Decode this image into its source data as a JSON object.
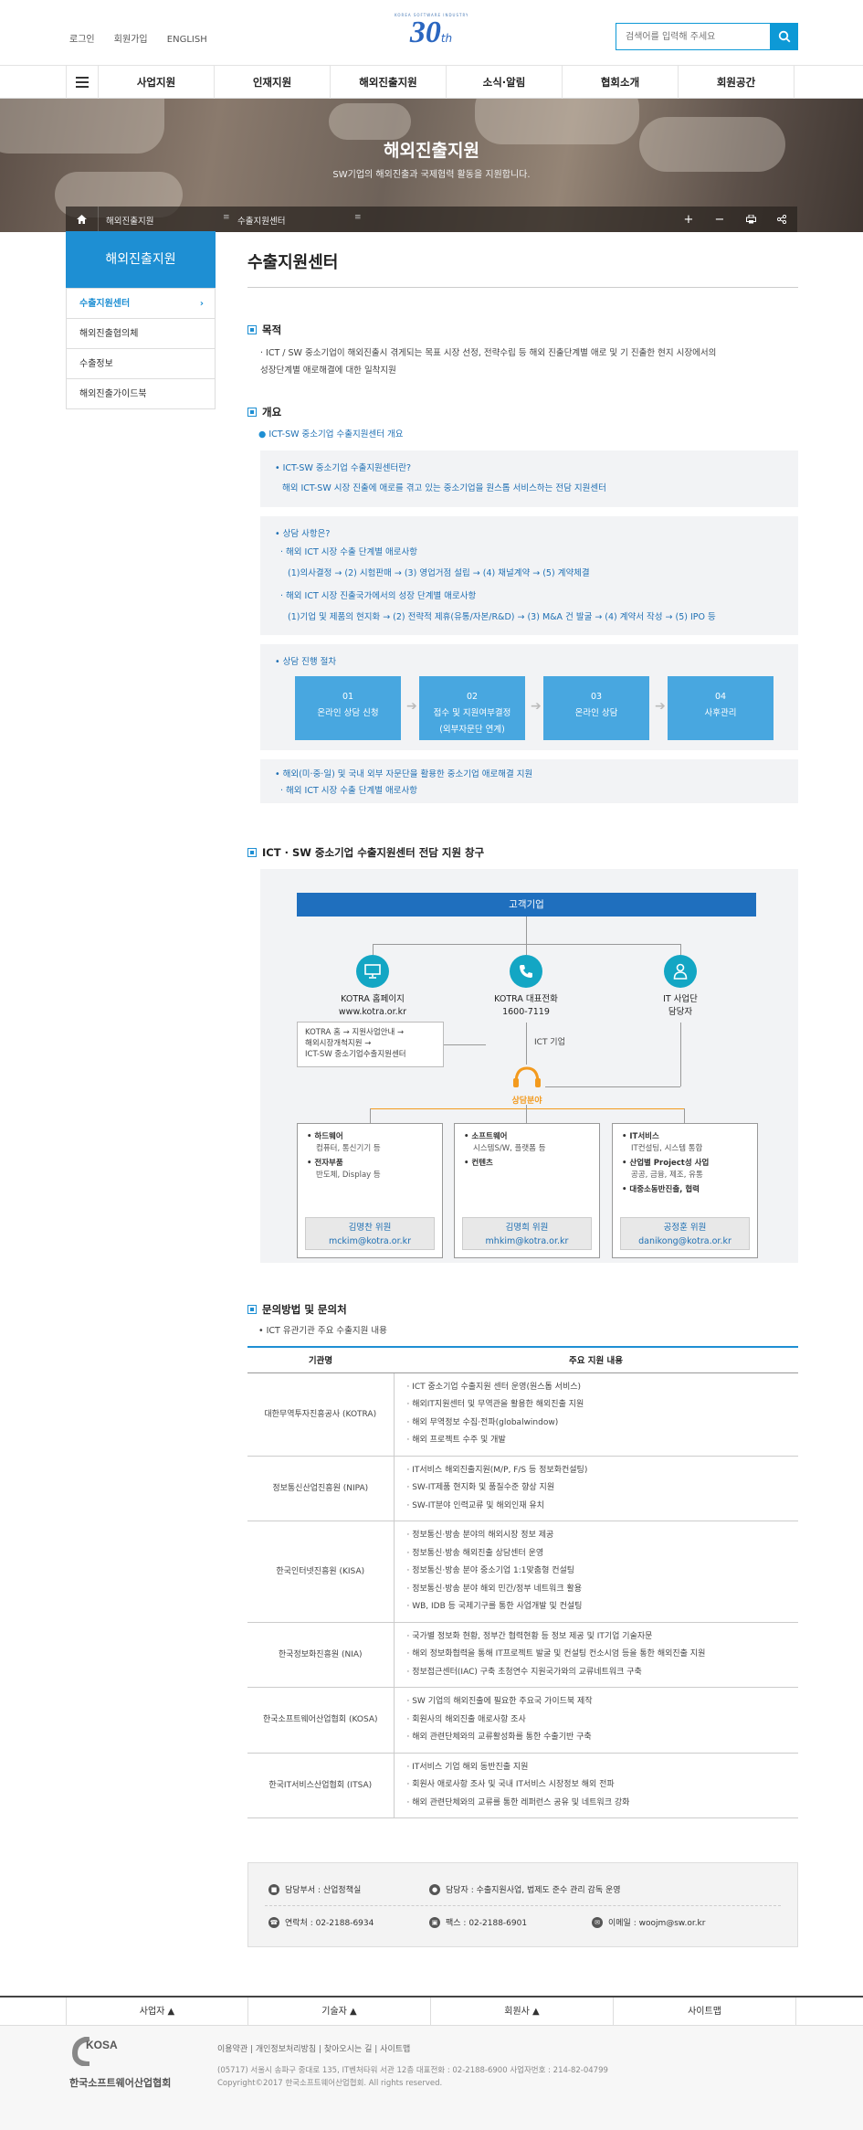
{
  "header": {
    "util_links": [
      "로그인",
      "회원가입",
      "ENGLISH"
    ],
    "logo_arc_text": "KOREA SOFTWARE INDUSTRY ASSOCIATION",
    "logo_number": "30",
    "logo_suffix": "th",
    "search_placeholder": "검색어를 입력해 주세요"
  },
  "nav": {
    "items": [
      "사업지원",
      "인재지원",
      "해외진출지원",
      "소식·알림",
      "협회소개",
      "회원공간"
    ]
  },
  "banner": {
    "title": "해외진출지원",
    "subtitle": "SW기업의 해외진출과 국제협력 활동을 지원합니다."
  },
  "breadcrumb": {
    "level1": "해외진출지원",
    "level2": "수출지원센터"
  },
  "sidebar": {
    "title": "해외진출지원",
    "items": [
      "수출지원센터",
      "해외진출협의체",
      "수출정보",
      "해외진출가이드북"
    ]
  },
  "page_title": "수출지원센터",
  "purpose": {
    "heading": "목적",
    "text1": "· ICT / SW 중소기업이 해외진출시 겪게되는 목표 시장 선정, 전략수립 등 해외 진출단계별 애로 및 기 진출한 현지 시장에서의",
    "text2": "성장단계별 애로해결에 대한 일착지원"
  },
  "overview": {
    "heading": "개요",
    "sub": "ICT-SW 중소기업 수출지원센터 개요",
    "q1": "• ICT-SW 중소기업 수출지원센터란?",
    "a1": "해외 ICT-SW 시장 진출에 애로를 겪고 있는 중소기업을 원스톱 서비스하는 전담 지원센터",
    "q2": "• 상담 사항은?",
    "l1": "· 해외 ICT 시장 수출 단계별 애로사항",
    "l1d": "(1)의사결정 → (2) 시험판매 → (3) 영업거점 설립 → (4) 채널계약 → (5) 계약체결",
    "l2": "· 해외 ICT 시장 진출국가에서의 성장 단계별 애로사항",
    "l2d": "(1)기업 및 제품의 현지화 → (2) 전략적 제휴(유통/자본/R&D) → (3) M&A 건 발굴 → (4) 계약서 작성 → (5) IPO 등",
    "q3": "• 상담 진행 절차",
    "steps": [
      {
        "num": "01",
        "label": "온라인 상담 신청",
        "label2": ""
      },
      {
        "num": "02",
        "label": "접수 및 지원여부결정",
        "label2": "(외부자문단 연계)"
      },
      {
        "num": "03",
        "label": "온라인 상담",
        "label2": ""
      },
      {
        "num": "04",
        "label": "사후관리",
        "label2": ""
      }
    ],
    "q4": "• 해외(미·중·일) 및 국내 외부 자문단을 활용한 중소기업 애로해결 지원",
    "l4": "· 해외 ICT 시장 수출 단계별 애로사항"
  },
  "diagram": {
    "heading": "ICT · SW 중소기업 수출지원센터 전담 지원 창구",
    "customer": "고객기업",
    "c1_title": "KOTRA 홈페이지",
    "c1_sub": "www.kotra.or.kr",
    "c2_title": "KOTRA 대표전화",
    "c2_sub": "1600-7119",
    "c3_title": "IT 사업단",
    "c3_sub": "담당자",
    "path1": "KOTRA 홈 → 지원사업안내 →",
    "path2": "해외시장개척지원 →",
    "path3": "ICT-SW 중소기업수출지원센터",
    "ict_label": "ICT 기업",
    "consult_label": "상담분야",
    "fields": [
      {
        "h1": "• 하드웨어",
        "d1": "컴퓨터, 통신기기 등",
        "h2": "• 전자부품",
        "d2": "반도체, Display 등",
        "h3": "",
        "d3": "",
        "person": "김명찬 위원",
        "email": "mckim@kotra.or.kr"
      },
      {
        "h1": "• 소프트웨어",
        "d1": "시스템S/W, 플랫폼 등",
        "h2": "• 컨텐츠",
        "d2": "",
        "h3": "",
        "d3": "",
        "person": "김명희 위원",
        "email": "mhkim@kotra.or.kr"
      },
      {
        "h1": "• IT서비스",
        "d1": "IT컨설팅, 시스템 통합",
        "h2": "• 산업별 Project성 사업",
        "d2": "공공, 금융, 제조, 유통",
        "h3": "• 대중소동반진출, 협력",
        "d3": "",
        "person": "공정훈 위원",
        "email": "danikong@kotra.or.kr"
      }
    ]
  },
  "contact_section": {
    "heading": "문의방법 및 문의처",
    "sub": "• ICT 유관기관 주요 수출지원 내용",
    "col1": "기관명",
    "col2": "주요 지원 내용",
    "rows": [
      {
        "org": "대한무역투자진흥공사 (KOTRA)",
        "items": [
          "· ICT 중소기업 수출지원 센터 운영(원스톱 서비스)",
          "· 해외IT지원센터 및 무역관을 활용한 해외진출 지원",
          "· 해외 무역정보 수집·전파(globalwindow)",
          "· 해외 프로젝트 수주 및 개발"
        ]
      },
      {
        "org": "정보통신산업진흥원 (NIPA)",
        "items": [
          "· IT서비스 해외진출지원(M/P, F/S 등 정보화컨설팅)",
          "· SW-IT제품 현지화 및 품질수준 향상 지원",
          "· SW-IT분야 인력교류 및 해외인재 유치"
        ]
      },
      {
        "org": "한국인터넷진흥원 (KISA)",
        "items": [
          "· 정보통신·방송 분야의 해외시장 정보 제공",
          "· 정보통신·방송 해외진출 상담센터 운영",
          "· 정보통신·방송 분야 중소기업 1:1맞춤형 컨설팅",
          "· 정보통신·방송 분야 해외 민간/정부 네트워크 활용",
          "· WB, IDB 등 국제기구를 통한 사업개발 및 컨설팅"
        ]
      },
      {
        "org": "한국정보화진흥원 (NIA)",
        "items": [
          "· 국가별 정보화 현황, 정부간 협력현황 등 정보 제공 및 IT기업 기술자문",
          "· 해외 정보화협력을 통해 IT프로젝트 발굴 및 컨설팅 컨소시엄 등을 통한 해외진출 지원",
          "· 정보접근센터(IAC) 구축 초청연수 지원국가와의 교류네트워크 구축"
        ]
      },
      {
        "org": "한국소프트웨어산업협회 (KOSA)",
        "items": [
          "· SW 기업의 해외진출에 필요한 주요국 가이드북 제작",
          "· 회원사의 해외진출 애로사항 조사",
          "· 해외 관련단체와의 교류활성화를 통한 수출기반 구축"
        ]
      },
      {
        "org": "한국IT서비스산업협회 (ITSA)",
        "items": [
          "· IT서비스 기업 해외 동반진출 지원",
          "· 회원사 애로사항 조사 및 국내 IT서비스 시장정보 해외 전파",
          "· 해외 관련단체와의 교류를 통한 레퍼런스 공유 및 네트워크 강화"
        ]
      }
    ]
  },
  "info": {
    "dept": "담당부서 : 산업정책실",
    "manager": "담당자 : 수출지원사업, 법제도 준수 관리 감독 운영",
    "tel": "연락처 : 02-2188-6934",
    "fax": "팩스 : 02-2188-6901",
    "email": "이메일 : woojm@sw.or.kr"
  },
  "footer": {
    "nav": [
      "사업자 ▲",
      "기술자 ▲",
      "회원사 ▲",
      "사이트맵"
    ],
    "logo_text": "KOSA",
    "org_name": "한국소프트웨어산업협회",
    "links": "이용약관 | 개인정보처리방침 | 찾아오시는 길 | 사이트맵",
    "address": "(05717) 서울시 송파구 중대로 135, IT벤처타워 서관 12층 대표전화 : 02-2188-6900 사업자번호 : 214-82-04799",
    "copyright": "Copyright©2017 한국소프트웨어산업협회. All rights reserved."
  }
}
